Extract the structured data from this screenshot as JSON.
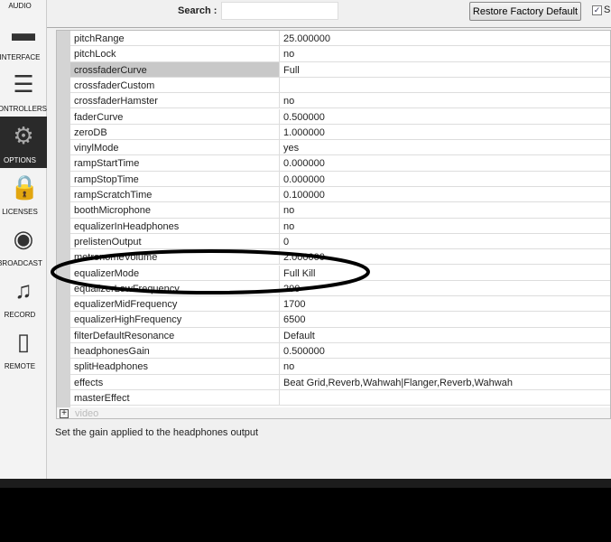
{
  "sidebar": {
    "items": [
      {
        "label": "AUDIO",
        "icon": "speaker-icon"
      },
      {
        "label": "INTERFACE",
        "icon": "monitor-icon"
      },
      {
        "label": "CONTROLLERS",
        "icon": "sliders-icon"
      },
      {
        "label": "OPTIONS",
        "icon": "gear-icon",
        "active": true
      },
      {
        "label": "LICENSES",
        "icon": "lock-icon"
      },
      {
        "label": "BROADCAST",
        "icon": "broadcast-icon"
      },
      {
        "label": "RECORD",
        "icon": "record-folder-icon"
      },
      {
        "label": "REMOTE",
        "icon": "tablet-icon"
      }
    ]
  },
  "toolbar": {
    "search_label": "Search :",
    "search_value": "",
    "restore_label": "Restore Factory Default",
    "checkbox_label": "S",
    "checkbox_checked": true
  },
  "table": {
    "rows": [
      {
        "key": "pitchRange",
        "value": "25.000000"
      },
      {
        "key": "pitchLock",
        "value": "no"
      },
      {
        "key": "crossfaderCurve",
        "value": "Full",
        "selected": true
      },
      {
        "key": "crossfaderCustom",
        "value": ""
      },
      {
        "key": "crossfaderHamster",
        "value": "no"
      },
      {
        "key": "faderCurve",
        "value": "0.500000"
      },
      {
        "key": "zeroDB",
        "value": "1.000000"
      },
      {
        "key": "vinylMode",
        "value": "yes"
      },
      {
        "key": "rampStartTime",
        "value": "0.000000"
      },
      {
        "key": "rampStopTime",
        "value": "0.000000"
      },
      {
        "key": "rampScratchTime",
        "value": "0.100000"
      },
      {
        "key": "boothMicrophone",
        "value": "no"
      },
      {
        "key": "equalizerInHeadphones",
        "value": "no"
      },
      {
        "key": "prelistenOutput",
        "value": "0"
      },
      {
        "key": "metronomeVolume",
        "value": "2.000000"
      },
      {
        "key": "equalizerMode",
        "value": "Full Kill"
      },
      {
        "key": "equalizerLowFrequency",
        "value": "200"
      },
      {
        "key": "equalizerMidFrequency",
        "value": "1700"
      },
      {
        "key": "equalizerHighFrequency",
        "value": "6500"
      },
      {
        "key": "filterDefaultResonance",
        "value": "Default"
      },
      {
        "key": "headphonesGain",
        "value": "0.500000"
      },
      {
        "key": "splitHeadphones",
        "value": "no"
      },
      {
        "key": "effects",
        "value": "Beat Grid,Reverb,Wahwah|Flanger,Reverb,Wahwah"
      },
      {
        "key": "masterEffect",
        "value": ""
      }
    ],
    "group": "video"
  },
  "description": "Set the gain applied to the headphones output"
}
